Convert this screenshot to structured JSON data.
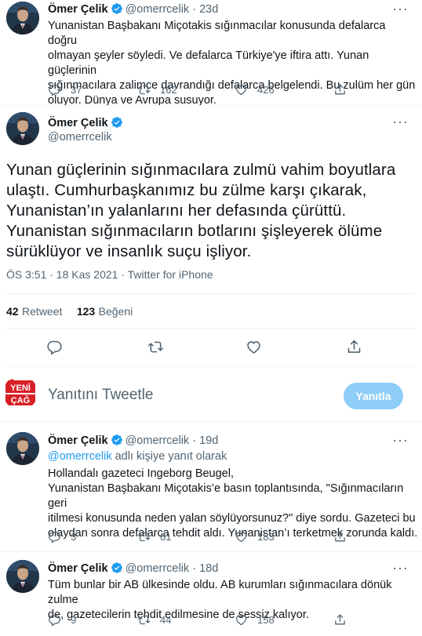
{
  "tweet1": {
    "name": "Ömer Çelik",
    "handle": "@omerrcelik",
    "time": "23d",
    "text_lines": [
      "Yunanistan Başbakanı Miçotakis sığınmacılar konusunda defalarca doğru",
      "olmayan şeyler söyledi. Ve defalarca Türkiye'ye iftira attı. Yunan güçlerinin",
      "sığınmacılara zalimce davrandığı defalarca belgelendi. Bu zulüm her gün",
      "oluyor. Dünya ve Avrupa susuyor."
    ],
    "replies": "37",
    "retweets": "162",
    "likes": "426"
  },
  "main": {
    "name": "Ömer Çelik",
    "handle": "@omerrcelik",
    "text_lines": [
      "Yunan güçlerinin sığınmacılara zulmü vahim boyutlara",
      "ulaştı. Cumhurbaşkanımız bu zülme karşı çıkarak,",
      "Yunanistan’ın yalanlarını her defasında çürüttü.",
      "Yunanistan sığınmacıların botlarını şişleyerek ölüme",
      "sürüklüyor ve insanlık suçu işliyor."
    ],
    "meta": "ÖS 3:51 · 18 Kas 2021 · Twitter for iPhone",
    "retweet_count": "42",
    "retweet_label": "Retweet",
    "like_count": "123",
    "like_label": "Beğeni"
  },
  "composer": {
    "logo_text_1": "YENİ",
    "logo_text_2": "ÇAĞ",
    "placeholder": "Yanıtını Tweetle",
    "button": "Yanıtla"
  },
  "tweet3": {
    "name": "Ömer Çelik",
    "handle": "@omerrcelik",
    "time": "19d",
    "reply_to_handle": "@omerrcelik",
    "reply_to_suffix": " adlı kişiye yanıt olarak",
    "text_lines": [
      "Hollandalı gazeteci Ingeborg Beugel,",
      "Yunanistan Başbakanı Miçotakis’e basın toplantısında, \"Sığınmacıların geri",
      "itilmesi konusunda neden yalan söylüyorsunuz?\" diye sordu. Gazeteci bu",
      "olaydan sonra defalarca tehdit aldı. Yunanistan’ı terketmek zorunda kaldı."
    ],
    "replies": "3",
    "retweets": "61",
    "likes": "183"
  },
  "tweet4": {
    "name": "Ömer Çelik",
    "handle": "@omerrcelik",
    "time": "18d",
    "text_lines": [
      "Tüm bunlar bir AB ülkesinde oldu. AB kurumları sığınmacılara dönük zulme",
      "de, gazetecilerin tehdit edilmesine de sessiz kalıyor."
    ],
    "replies": "9",
    "retweets": "44",
    "likes": "158"
  },
  "colors": {
    "accent": "#1d9bf0",
    "muted": "#536471",
    "reply_button": "#8ecdf8",
    "divider": "#eff3f4",
    "logo_red": "#d81f26"
  }
}
